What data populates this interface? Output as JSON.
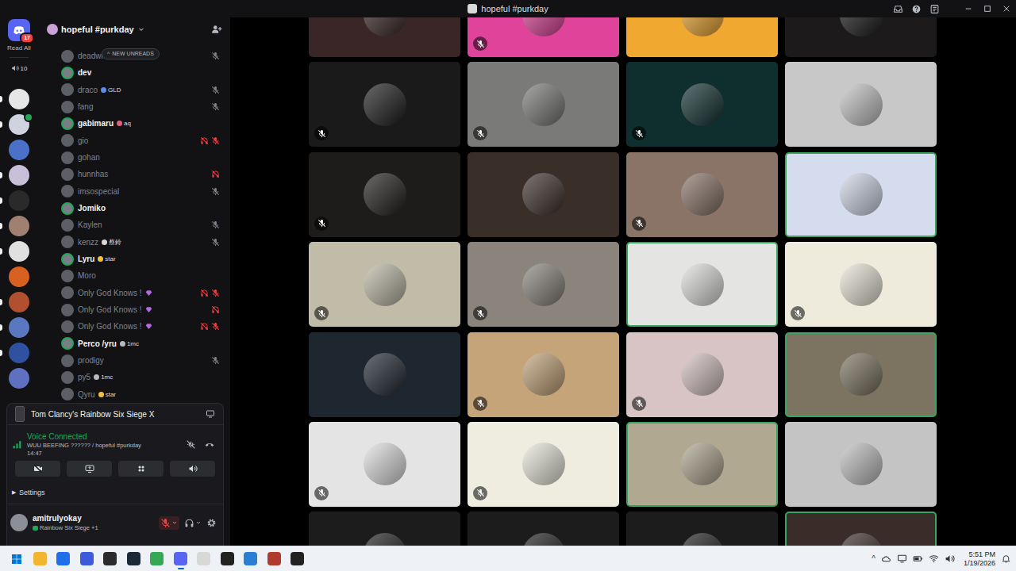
{
  "window": {
    "title": "hopeful #purkday"
  },
  "rail": {
    "home_badge": "17",
    "read_all": "Read All",
    "dm_count": "10",
    "servers": [
      {
        "color": "#e6e6e6",
        "unread": true,
        "online_dot": false
      },
      {
        "color": "#cfd3df",
        "unread": true,
        "online_dot": true
      },
      {
        "color": "#4a70c8",
        "unread": false,
        "online_dot": false
      },
      {
        "color": "#c8c0d8",
        "unread": true,
        "online_dot": false
      },
      {
        "color": "#2a2a2a",
        "unread": true,
        "online_dot": false
      },
      {
        "color": "#a08070",
        "unread": true,
        "online_dot": false
      },
      {
        "color": "#e0e0e0",
        "unread": true,
        "online_dot": false
      },
      {
        "color": "#d86020",
        "unread": false,
        "online_dot": false
      },
      {
        "color": "#b05030",
        "unread": true,
        "online_dot": false
      },
      {
        "color": "#5a78c0",
        "unread": true,
        "online_dot": false
      },
      {
        "color": "#3050a0",
        "unread": true,
        "online_dot": false
      },
      {
        "color": "#6070c0",
        "unread": false,
        "online_dot": false
      }
    ]
  },
  "channel": {
    "name": "hopeful #purkday",
    "new_unreads_icon": "^",
    "new_unreads": "NEW UNREADS",
    "members": [
      {
        "name": "deadwi",
        "active": false,
        "muted": true,
        "deafened": false,
        "gem": false,
        "tag": null
      },
      {
        "name": "dev",
        "active": true,
        "muted": false,
        "deafened": false,
        "gem": false,
        "tag": null
      },
      {
        "name": "draco",
        "active": false,
        "muted": true,
        "deafened": false,
        "gem": false,
        "tag": {
          "text": "GLD",
          "color": "#5b8def"
        }
      },
      {
        "name": "fang",
        "active": false,
        "muted": true,
        "deafened": false,
        "gem": false,
        "tag": null
      },
      {
        "name": "gabimaru",
        "active": true,
        "muted": false,
        "deafened": false,
        "gem": false,
        "tag": {
          "text": "aq",
          "color": "#e0607e"
        }
      },
      {
        "name": "gio",
        "active": false,
        "muted": true,
        "deafened": true,
        "gem": false,
        "tag": null
      },
      {
        "name": "gohan",
        "active": false,
        "muted": false,
        "deafened": false,
        "gem": false,
        "tag": null
      },
      {
        "name": "hunnhas",
        "active": false,
        "muted": false,
        "deafened": true,
        "gem": false,
        "tag": null
      },
      {
        "name": "imsospecial",
        "active": false,
        "muted": true,
        "deafened": false,
        "gem": false,
        "tag": null
      },
      {
        "name": "Jomiko",
        "active": true,
        "muted": false,
        "deafened": false,
        "gem": false,
        "tag": null
      },
      {
        "name": "Kaylen",
        "active": false,
        "muted": true,
        "deafened": false,
        "gem": false,
        "tag": null
      },
      {
        "name": "kenzz",
        "active": false,
        "muted": true,
        "deafened": false,
        "gem": false,
        "tag": {
          "text": "蔡鈴",
          "color": "#d8d8d8"
        }
      },
      {
        "name": "Lyru",
        "active": true,
        "muted": false,
        "deafened": false,
        "gem": false,
        "tag": {
          "text": "star",
          "color": "#f0c040"
        }
      },
      {
        "name": "Moro",
        "active": false,
        "muted": false,
        "deafened": false,
        "gem": false,
        "tag": null
      },
      {
        "name": "Only God Knows !",
        "active": false,
        "muted": true,
        "deafened": true,
        "gem": true,
        "tag": null
      },
      {
        "name": "Only God Knows !",
        "active": false,
        "muted": false,
        "deafened": true,
        "gem": true,
        "tag": null
      },
      {
        "name": "Only God Knows !",
        "active": false,
        "muted": true,
        "deafened": true,
        "gem": true,
        "tag": null
      },
      {
        "name": "Perco /yru",
        "active": true,
        "muted": false,
        "deafened": false,
        "gem": false,
        "tag": {
          "text": "1mc",
          "color": "#b5bac1"
        }
      },
      {
        "name": "prodigy",
        "active": false,
        "muted": true,
        "deafened": false,
        "gem": false,
        "tag": null
      },
      {
        "name": "py5",
        "active": false,
        "muted": false,
        "deafened": false,
        "gem": false,
        "tag": {
          "text": "1mc",
          "color": "#b5bac1"
        }
      },
      {
        "name": "Qyru",
        "active": false,
        "muted": false,
        "deafened": false,
        "gem": false,
        "tag": {
          "text": "star",
          "color": "#f0c040"
        }
      }
    ]
  },
  "activity": {
    "game": "Tom Clancy's Rainbow Six Siege X"
  },
  "voice": {
    "status": "Voice Connected",
    "channel": "WUU BEEFING ?????? / hopeful #purkday",
    "elapsed": "14:47"
  },
  "settings": {
    "expander": "▶",
    "label": "Settings",
    "expanded": false
  },
  "user": {
    "name": "amitrulyokay",
    "activity": "Rainbow Six Siege +1",
    "mic_muted": true
  },
  "tiles": [
    {
      "color": "#3a2626",
      "muted": false,
      "speaking": false
    },
    {
      "color": "#e0439a",
      "muted": true,
      "speaking": false
    },
    {
      "color": "#f0a830",
      "muted": false,
      "speaking": false
    },
    {
      "color": "#1c1a1a",
      "muted": false,
      "speaking": false
    },
    {
      "color": "#1a1a1a",
      "muted": true,
      "speaking": false
    },
    {
      "color": "#7a7a78",
      "muted": true,
      "speaking": false
    },
    {
      "color": "#0f2e2e",
      "muted": true,
      "speaking": false
    },
    {
      "color": "#c8c8c8",
      "muted": false,
      "speaking": false
    },
    {
      "color": "#1e1c1a",
      "muted": true,
      "speaking": false
    },
    {
      "color": "#3a2e28",
      "muted": false,
      "speaking": false
    },
    {
      "color": "#8a7468",
      "muted": true,
      "speaking": false
    },
    {
      "color": "#d4dcee",
      "muted": false,
      "speaking": true
    },
    {
      "color": "#c0bca8",
      "muted": true,
      "speaking": false
    },
    {
      "color": "#8a847c",
      "muted": true,
      "speaking": false
    },
    {
      "color": "#e4e4e2",
      "muted": false,
      "speaking": true
    },
    {
      "color": "#eeebdc",
      "muted": true,
      "speaking": false
    },
    {
      "color": "#1e2630",
      "muted": false,
      "speaking": false
    },
    {
      "color": "#c4a478",
      "muted": true,
      "speaking": false
    },
    {
      "color": "#d8c4c4",
      "muted": true,
      "speaking": false
    },
    {
      "color": "#7c7460",
      "muted": false,
      "speaking": true
    },
    {
      "color": "#e4e4e4",
      "muted": true,
      "speaking": false
    },
    {
      "color": "#eeede0",
      "muted": true,
      "speaking": false
    },
    {
      "color": "#b0a890",
      "muted": false,
      "speaking": true
    },
    {
      "color": "#c4c4c4",
      "muted": false,
      "speaking": false
    },
    {
      "color": "#1c1c1c",
      "muted": false,
      "speaking": false
    },
    {
      "color": "#1c1c1c",
      "muted": false,
      "speaking": false
    },
    {
      "color": "#1c1c1c",
      "muted": false,
      "speaking": false
    },
    {
      "color": "#3a2c28",
      "muted": false,
      "speaking": true
    }
  ],
  "taskbar": {
    "apps": [
      {
        "kind": "start",
        "color": "#0078d4",
        "active": false
      },
      {
        "kind": "app",
        "color": "#f2b530",
        "active": false
      },
      {
        "kind": "app",
        "color": "#1f6feb",
        "active": false
      },
      {
        "kind": "app",
        "color": "#3b5bdb",
        "active": false
      },
      {
        "kind": "app",
        "color": "#2b2b2b",
        "active": false
      },
      {
        "kind": "app",
        "color": "#1b2838",
        "active": false
      },
      {
        "kind": "app",
        "color": "#34a853",
        "active": false
      },
      {
        "kind": "app",
        "color": "#5865f2",
        "active": true
      },
      {
        "kind": "app",
        "color": "#d8d8d8",
        "active": false
      },
      {
        "kind": "app",
        "color": "#222222",
        "active": false
      },
      {
        "kind": "app",
        "color": "#2a7fd4",
        "active": false
      },
      {
        "kind": "app",
        "color": "#b03a2e",
        "active": false
      },
      {
        "kind": "app",
        "color": "#222222",
        "active": false
      }
    ],
    "tray_toggle": "^",
    "time": "5:51 PM",
    "date": "1/19/2026"
  }
}
